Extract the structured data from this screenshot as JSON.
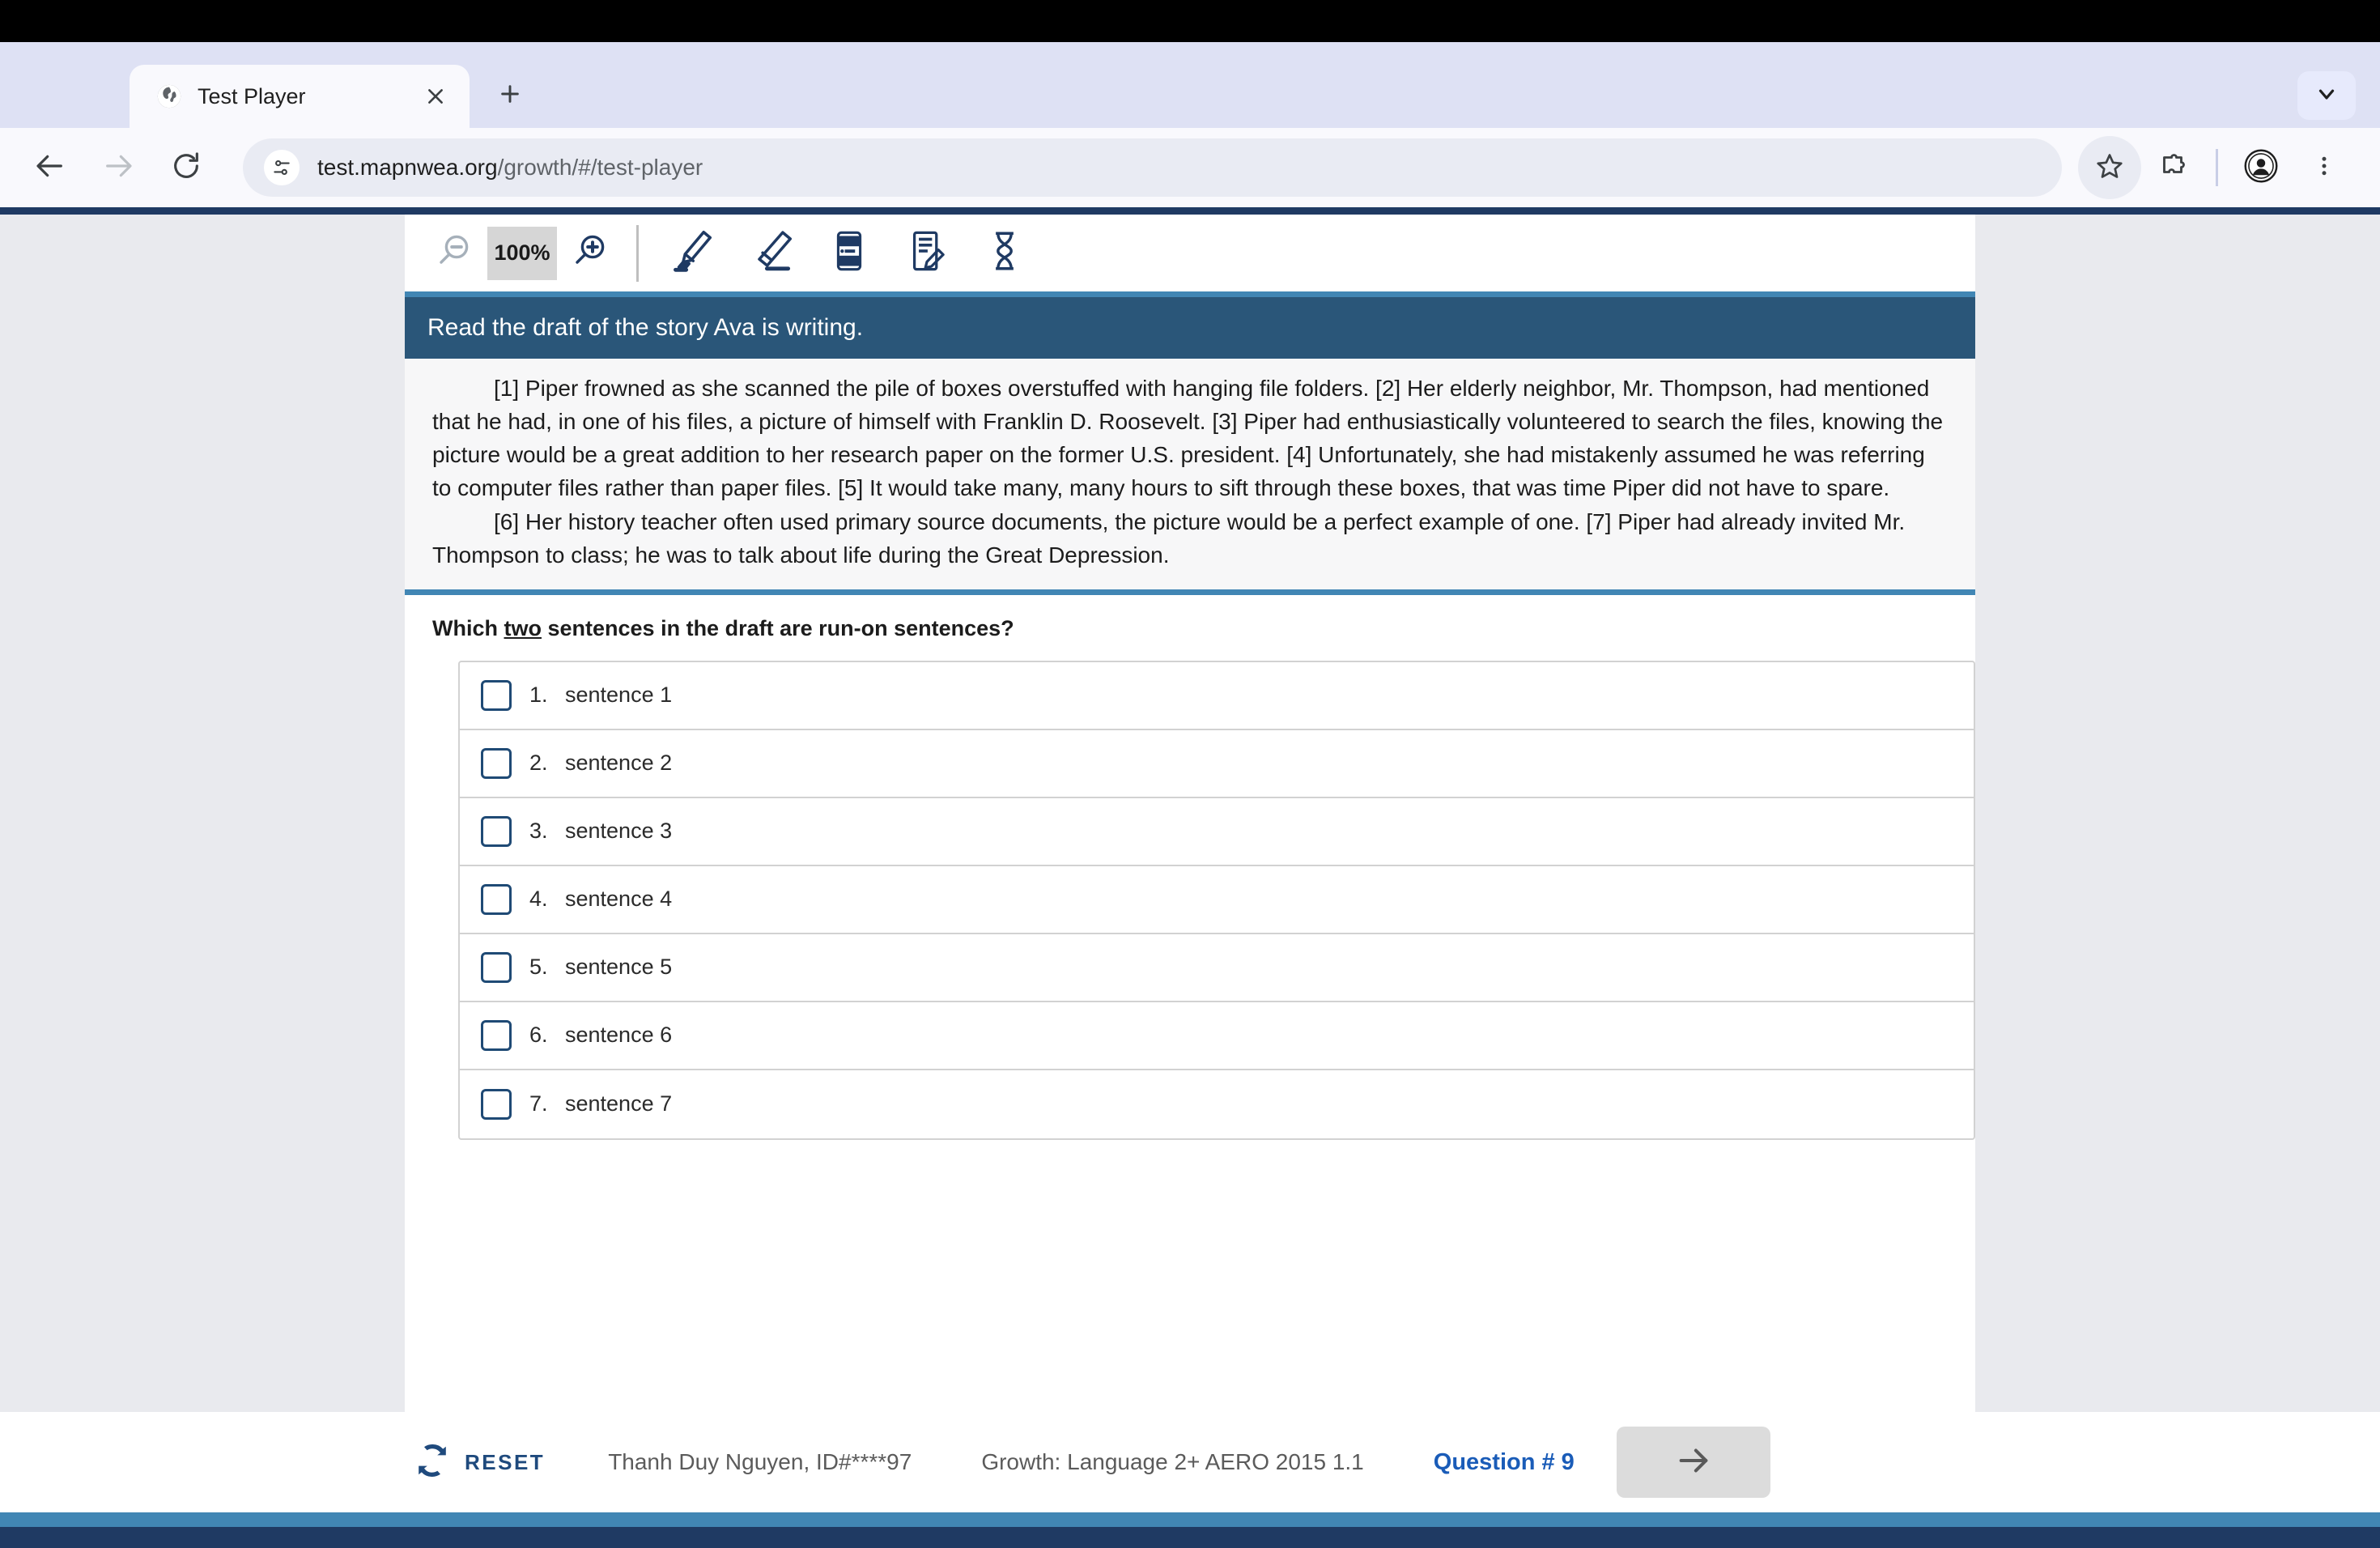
{
  "browser": {
    "tab": {
      "title": "Test Player",
      "favicon_icon": "globe-icon",
      "close_icon": "close-icon"
    },
    "new_tab_icon": "plus-icon",
    "tab_list_icon": "chevron-down-icon",
    "back_icon": "arrow-left-icon",
    "forward_icon": "arrow-right-icon",
    "reload_icon": "reload-icon",
    "omnibox": {
      "site_info_icon": "site-settings-icon",
      "url_host": "test.mapnwea.org",
      "url_path": "/growth/#/test-player",
      "url_full": "test.mapnwea.org/growth/#/test-player"
    },
    "bookmark_icon": "star-icon",
    "extensions_icon": "puzzle-piece-icon",
    "profile_icon": "profile-avatar-icon",
    "menu_icon": "three-dot-menu-icon"
  },
  "toolbar": {
    "zoom_out_icon": "magnifier-minus-icon",
    "zoom_level": "100%",
    "zoom_in_icon": "magnifier-plus-icon",
    "highlighter_icon": "highlighter-pen-icon",
    "eraser_icon": "eraser-icon",
    "line_reader_icon": "line-reader-icon",
    "notepad_icon": "notepad-pencil-icon",
    "answer_eliminator_icon": "answer-eliminator-icon"
  },
  "stimulus": {
    "header": "Read the draft of the story Ava is writing.",
    "paragraphs": [
      "[1] Piper frowned as she scanned the pile of boxes overstuffed with hanging file folders. [2] Her elderly neighbor, Mr. Thompson, had mentioned that he had, in one of his files, a picture of himself with Franklin D. Roosevelt. [3] Piper had enthusiastically volunteered to search the files, knowing the picture would be a great addition to her research paper on the former U.S. president. [4] Unfortunately, she had mistakenly assumed he was referring to computer files rather than paper files. [5] It would take many, many hours to sift through these boxes, that was time Piper did not have to spare.",
      "[6] Her history teacher often used primary source documents, the picture would be a perfect example of one. [7] Piper had already invited Mr. Thompson to class; he was to talk about life during the Great Depression."
    ]
  },
  "question": {
    "prompt_before": "Which ",
    "prompt_emphasis": "two",
    "prompt_after": " sentences in the draft are run-on sentences?",
    "choices": [
      {
        "num": "1.",
        "label": "sentence 1",
        "checked": false
      },
      {
        "num": "2.",
        "label": "sentence 2",
        "checked": false
      },
      {
        "num": "3.",
        "label": "sentence 3",
        "checked": false
      },
      {
        "num": "4.",
        "label": "sentence 4",
        "checked": false
      },
      {
        "num": "5.",
        "label": "sentence 5",
        "checked": false
      },
      {
        "num": "6.",
        "label": "sentence 6",
        "checked": false
      },
      {
        "num": "7.",
        "label": "sentence 7",
        "checked": false
      }
    ]
  },
  "footer": {
    "reset_icon": "refresh-circular-icon",
    "reset_label": "RESET",
    "student": "Thanh Duy Nguyen, ID#****97",
    "test_name": "Growth: Language 2+ AERO 2015 1.1",
    "question_counter": "Question # 9",
    "next_icon": "arrow-right-icon"
  },
  "colors": {
    "header_navy": "#2a5679",
    "accent_blue": "#4186b4",
    "deep_navy": "#1f3a63",
    "question_blue": "#1a5cb8",
    "reset_blue": "#1f4a7d"
  }
}
